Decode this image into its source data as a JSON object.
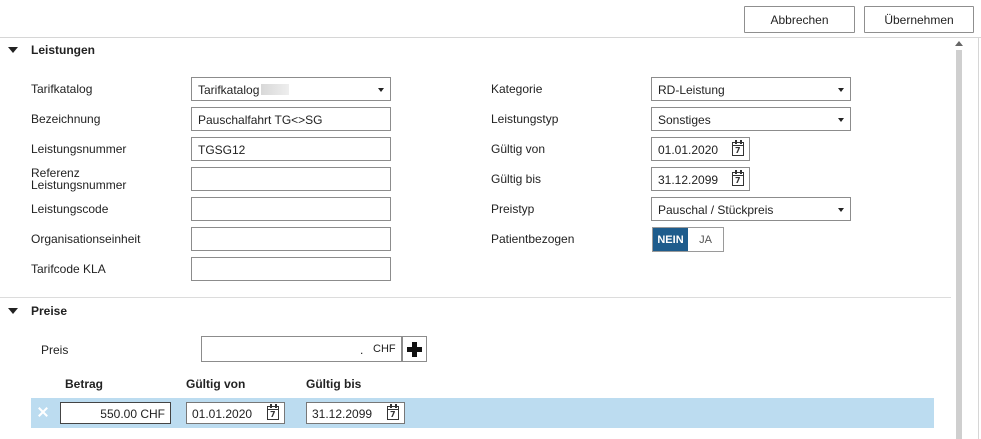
{
  "toolbar": {
    "cancel_label": "Abbrechen",
    "apply_label": "Übernehmen"
  },
  "leistungen": {
    "title": "Leistungen",
    "left": {
      "tarifkatalog": {
        "label": "Tarifkatalog",
        "value": "Tarifkatalog"
      },
      "bezeichnung": {
        "label": "Bezeichnung",
        "value": "Pauschalfahrt TG<>SG"
      },
      "leistungsnummer": {
        "label": "Leistungsnummer",
        "value": "TGSG12"
      },
      "referenz": {
        "label_line1": "Referenz",
        "label_line2": "Leistungsnummer",
        "value": ""
      },
      "leistungscode": {
        "label": "Leistungscode",
        "value": ""
      },
      "organisationseinheit": {
        "label": "Organisationseinheit",
        "value": ""
      },
      "tarifcode": {
        "label": "Tarifcode KLA",
        "value": ""
      }
    },
    "right": {
      "kategorie": {
        "label": "Kategorie",
        "value": "RD-Leistung"
      },
      "leistungstyp": {
        "label": "Leistungstyp",
        "value": "Sonstiges"
      },
      "gueltig_von": {
        "label": "Gültig von",
        "value": "01.01.2020"
      },
      "gueltig_bis": {
        "label": "Gültig bis",
        "value": "31.12.2099"
      },
      "preistyp": {
        "label": "Preistyp",
        "value": "Pauschal / Stückpreis"
      },
      "patientbezogen": {
        "label": "Patientbezogen",
        "options": [
          "NEIN",
          "JA"
        ],
        "selected": "NEIN"
      }
    }
  },
  "preise": {
    "title": "Preise",
    "preis": {
      "label": "Preis",
      "decimal": ".",
      "currency": "CHF"
    },
    "columns": {
      "betrag": "Betrag",
      "gueltig_von": "Gültig von",
      "gueltig_bis": "Gültig bis"
    },
    "rows": [
      {
        "betrag": "550.00 CHF",
        "gueltig_von": "01.01.2020",
        "gueltig_bis": "31.12.2099"
      }
    ]
  },
  "colors": {
    "accent": "#1e5c8c",
    "row_highlight": "#bcdcf0"
  },
  "icons": {
    "calendar": "calendar-icon",
    "add": "plus-icon",
    "delete": "close-icon",
    "collapse": "triangle-down-icon"
  }
}
